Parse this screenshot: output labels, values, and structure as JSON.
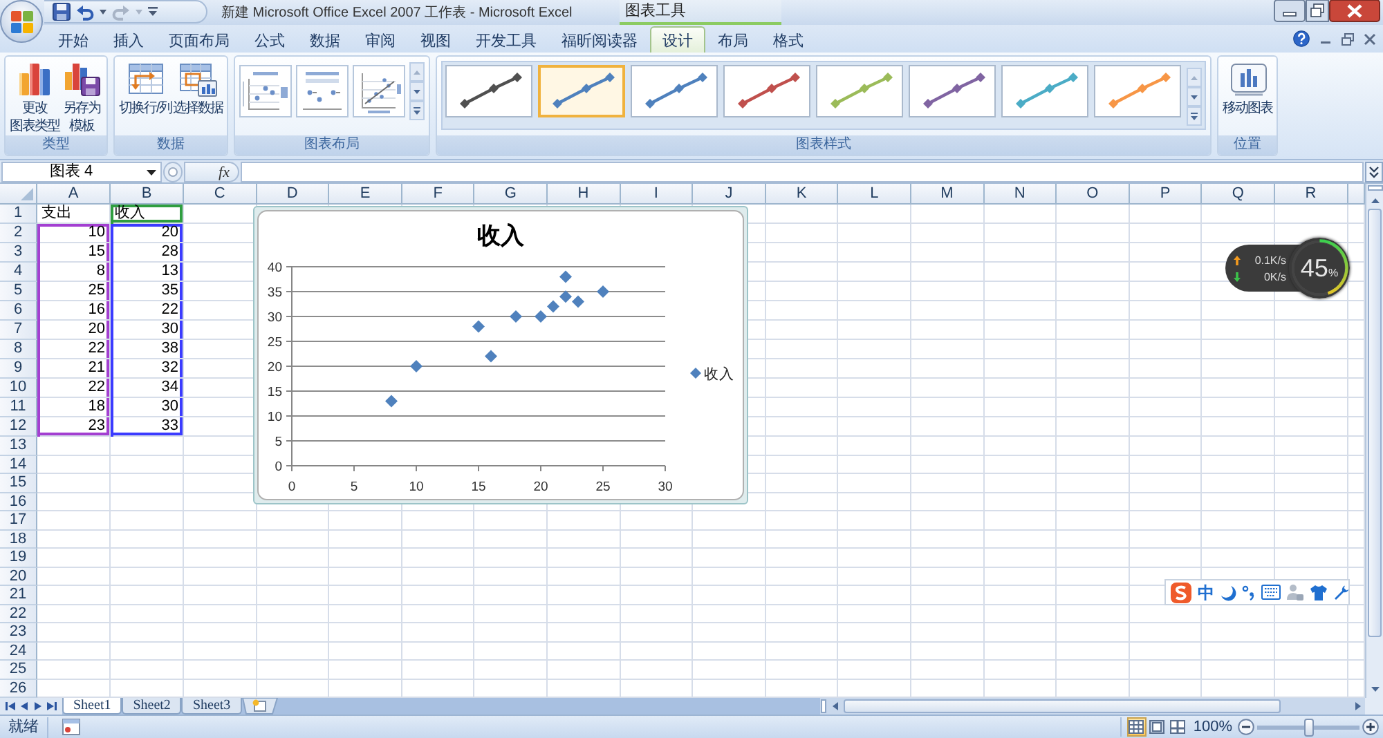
{
  "window": {
    "title": "新建 Microsoft Office Excel 2007 工作表 - Microsoft Excel",
    "context_group": "图表工具"
  },
  "ribbon_tabs": [
    {
      "label": "开始",
      "selected": false
    },
    {
      "label": "插入",
      "selected": false
    },
    {
      "label": "页面布局",
      "selected": false
    },
    {
      "label": "公式",
      "selected": false
    },
    {
      "label": "数据",
      "selected": false
    },
    {
      "label": "审阅",
      "selected": false
    },
    {
      "label": "视图",
      "selected": false
    },
    {
      "label": "开发工具",
      "selected": false
    },
    {
      "label": "福昕阅读器",
      "selected": false
    },
    {
      "label": "设计",
      "selected": true
    },
    {
      "label": "布局",
      "selected": false
    },
    {
      "label": "格式",
      "selected": false
    }
  ],
  "ribbon_groups": [
    {
      "kind": "buttons",
      "title": "类型",
      "buttons": [
        {
          "lines": [
            "更改",
            "图表类型"
          ]
        },
        {
          "lines": [
            "另存为",
            "模板"
          ]
        }
      ]
    },
    {
      "kind": "buttons",
      "title": "数据",
      "buttons": [
        {
          "lines": [
            "切换行/列"
          ]
        },
        {
          "lines": [
            "选择数据"
          ]
        }
      ]
    },
    {
      "kind": "layouts",
      "title": "图表布局",
      "items": [
        {
          "selected": false
        },
        {
          "selected": false
        },
        {
          "selected": false
        }
      ]
    },
    {
      "kind": "styles",
      "title": "图表样式",
      "items": [
        {
          "color": "#505050",
          "selected": false
        },
        {
          "color": "#4f81bd",
          "selected": true
        },
        {
          "color": "#4f81bd",
          "selected": false
        },
        {
          "color": "#c0504d",
          "selected": false
        },
        {
          "color": "#9bbb59",
          "selected": false
        },
        {
          "color": "#8064a2",
          "selected": false
        },
        {
          "color": "#4bacc6",
          "selected": false
        },
        {
          "color": "#f79646",
          "selected": false
        }
      ]
    },
    {
      "kind": "buttons",
      "title": "位置",
      "buttons": [
        {
          "lines": [
            "移动图表"
          ]
        }
      ]
    }
  ],
  "formula_bar": {
    "name_box": "图表 4",
    "function_label": "fx"
  },
  "sheet": {
    "columns": [
      "A",
      "B",
      "C",
      "D",
      "E",
      "F",
      "G",
      "H",
      "I",
      "J",
      "K",
      "L",
      "M",
      "N",
      "O",
      "P",
      "Q",
      "R"
    ],
    "rows": [
      {
        "label": "1",
        "cells": [
          {
            "text": "支出",
            "kind": "text"
          },
          {
            "text": "收入",
            "kind": "text",
            "color": "#2f9e3f"
          }
        ]
      },
      {
        "label": "2",
        "cells": [
          {
            "text": "10",
            "kind": "number",
            "color": "#a33fd1"
          },
          {
            "text": "20",
            "kind": "number",
            "color": "#3b3bff"
          }
        ]
      },
      {
        "label": "3",
        "cells": [
          {
            "text": "15",
            "kind": "number",
            "color": "#a33fd1"
          },
          {
            "text": "28",
            "kind": "number",
            "color": "#3b3bff"
          }
        ]
      },
      {
        "label": "4",
        "cells": [
          {
            "text": "8",
            "kind": "number",
            "color": "#a33fd1"
          },
          {
            "text": "13",
            "kind": "number",
            "color": "#3b3bff"
          }
        ]
      },
      {
        "label": "5",
        "cells": [
          {
            "text": "25",
            "kind": "number",
            "color": "#a33fd1"
          },
          {
            "text": "35",
            "kind": "number",
            "color": "#3b3bff"
          }
        ]
      },
      {
        "label": "6",
        "cells": [
          {
            "text": "16",
            "kind": "number",
            "color": "#a33fd1"
          },
          {
            "text": "22",
            "kind": "number",
            "color": "#3b3bff"
          }
        ]
      },
      {
        "label": "7",
        "cells": [
          {
            "text": "20",
            "kind": "number",
            "color": "#a33fd1"
          },
          {
            "text": "30",
            "kind": "number",
            "color": "#3b3bff"
          }
        ]
      },
      {
        "label": "8",
        "cells": [
          {
            "text": "22",
            "kind": "number",
            "color": "#a33fd1"
          },
          {
            "text": "38",
            "kind": "number",
            "color": "#3b3bff"
          }
        ]
      },
      {
        "label": "9",
        "cells": [
          {
            "text": "21",
            "kind": "number",
            "color": "#a33fd1"
          },
          {
            "text": "32",
            "kind": "number",
            "color": "#3b3bff"
          }
        ]
      },
      {
        "label": "10",
        "cells": [
          {
            "text": "22",
            "kind": "number",
            "color": "#a33fd1"
          },
          {
            "text": "34",
            "kind": "number",
            "color": "#3b3bff"
          }
        ]
      },
      {
        "label": "11",
        "cells": [
          {
            "text": "18",
            "kind": "number",
            "color": "#a33fd1"
          },
          {
            "text": "30",
            "kind": "number",
            "color": "#3b3bff"
          }
        ]
      },
      {
        "label": "12",
        "cells": [
          {
            "text": "23",
            "kind": "number",
            "color": "#a33fd1"
          },
          {
            "text": "33",
            "kind": "number",
            "color": "#3b3bff"
          }
        ]
      },
      {
        "label": "13"
      },
      {
        "label": "14"
      },
      {
        "label": "15"
      },
      {
        "label": "16"
      },
      {
        "label": "17"
      },
      {
        "label": "18"
      },
      {
        "label": "19"
      },
      {
        "label": "20"
      },
      {
        "label": "21"
      },
      {
        "label": "22"
      },
      {
        "label": "23"
      },
      {
        "label": "24"
      },
      {
        "label": "25"
      },
      {
        "label": "26"
      }
    ]
  },
  "chart": {
    "chart_data": {
      "type": "scatter",
      "title": "收入",
      "x": [
        10,
        15,
        8,
        25,
        16,
        20,
        22,
        21,
        22,
        18,
        23
      ],
      "series": [
        {
          "name": "收入",
          "color": "#4f81bd",
          "values": [
            20,
            28,
            13,
            35,
            22,
            30,
            38,
            32,
            34,
            30,
            33
          ]
        }
      ],
      "xlim": [
        0,
        30
      ],
      "ylim": [
        0,
        40
      ],
      "xticks": [
        0,
        5,
        10,
        15,
        20,
        25,
        30
      ],
      "yticks": [
        0,
        5,
        10,
        15,
        20,
        25,
        30,
        35,
        40
      ],
      "grid": true
    }
  },
  "speed_widget": {
    "upload": "0.1K/s",
    "download": "0K/s",
    "percent": "45$_{%}$",
    "level": 0.45
  },
  "ime_bar": {
    "mode": "中"
  },
  "sheet_tabs": [
    {
      "label": "Sheet1",
      "selected": true
    },
    {
      "label": "Sheet2",
      "selected": false
    },
    {
      "label": "Sheet3",
      "selected": false
    }
  ],
  "status_bar": {
    "text": "就绪",
    "views": [
      {
        "selected": true
      },
      {
        "selected": false
      },
      {
        "selected": false
      }
    ],
    "zoom": "100%",
    "zoom_slider": {
      "level": 0.5
    }
  }
}
